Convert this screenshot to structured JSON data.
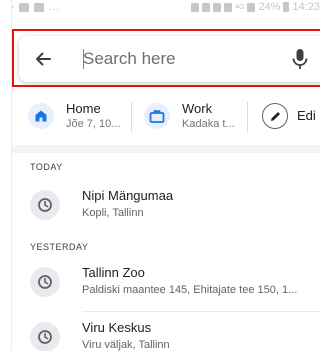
{
  "status_bar": {
    "notification_dots": "...",
    "network": "4G",
    "battery": "24%",
    "time": "14:23"
  },
  "search": {
    "placeholder": "Search here",
    "value": ""
  },
  "chips": [
    {
      "title": "Home",
      "subtitle": "Jõe 7, 10..."
    },
    {
      "title": "Work",
      "subtitle": "Kadaka t..."
    },
    {
      "title": "Edi"
    }
  ],
  "history": {
    "sections": [
      {
        "label": "TODAY",
        "items": [
          {
            "title": "Nipi Mängumaa",
            "subtitle": "Kopli, Tallinn"
          }
        ]
      },
      {
        "label": "YESTERDAY",
        "items": [
          {
            "title": "Tallinn Zoo",
            "subtitle": "Paldiski maantee 145, Ehitajate tee 150, 1..."
          },
          {
            "title": "Viru Keskus",
            "subtitle": "Viru väljak, Tallinn"
          }
        ]
      }
    ]
  },
  "colors": {
    "highlight": "#e8120c",
    "accent": "#4285f4",
    "home_icon": "#1a73e8"
  }
}
